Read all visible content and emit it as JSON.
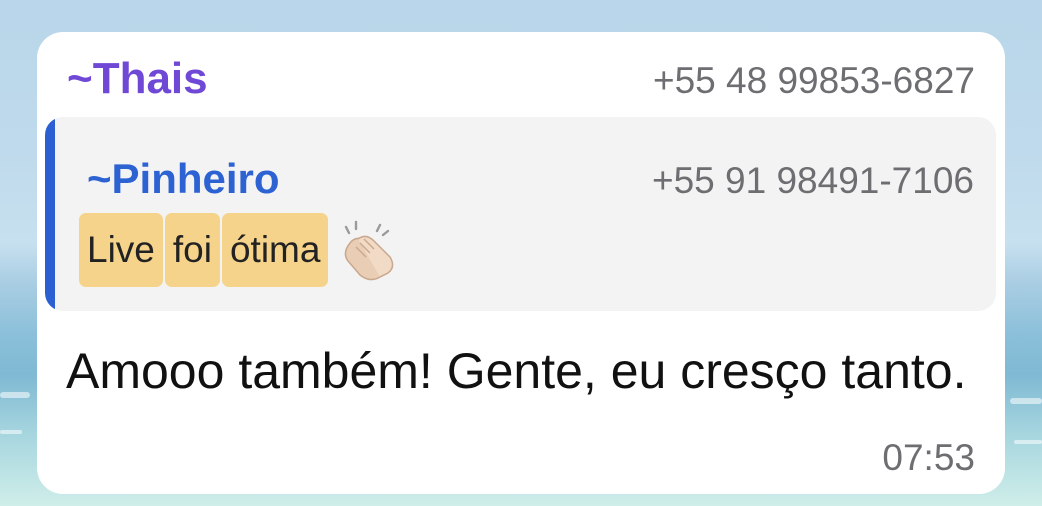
{
  "message": {
    "sender": {
      "prefix": "~",
      "name": "Thais",
      "phone": "+55 48 99853-6827",
      "color": "#6f49d6"
    },
    "quoted": {
      "prefix": "~",
      "name": "Pinheiro",
      "phone": "+55 91 98491-7106",
      "color": "#2c62d2",
      "text_segments": [
        "Live",
        "foi",
        "ótima"
      ],
      "emoji": "clapping-hands-icon",
      "highlight_color": "#f5d38a"
    },
    "body": "Amooo também! Gente, eu cresço tanto.",
    "time": "07:53"
  }
}
